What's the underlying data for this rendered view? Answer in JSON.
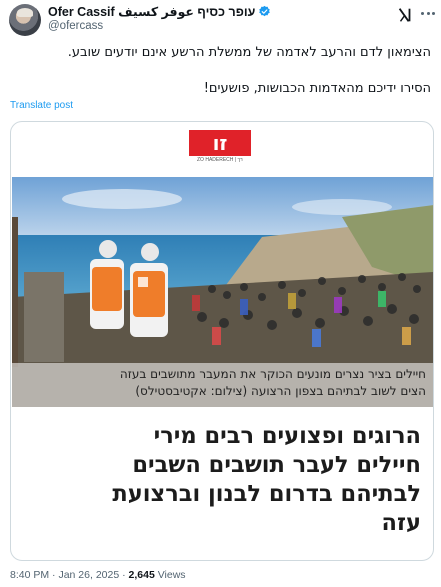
{
  "author": {
    "display_name": "Ofer Cassif עופר כסיף عوفر كسيف",
    "handle": "@ofercass",
    "verified": true
  },
  "icons": {
    "verified": "verified-badge-icon",
    "grok": "grok-icon",
    "more": "more-icon"
  },
  "colors": {
    "link": "#1d9bf0",
    "muted": "#536471",
    "logo_red": "#e02229"
  },
  "tweet": {
    "line1": "הצימאון לדם והרעב לאדמה של ממשלת הרשע אינם יודעים שובע.",
    "line2": "הסירו ידיכם מהאדמות הכבושות, פושעים!",
    "translate_label": "Translate post"
  },
  "article": {
    "logo_text": "זו הדרך",
    "logo_sub": "ZO HADERECH | זו הדרך",
    "caption_line1": "חיילים בציר נצרים מונעים הכוקר את המעבר מתושבים בעזה",
    "caption_line2": "הצים לשוב לבתיהם בצפון הרצועה (צילום: אקטיבסטילס)",
    "headline_lines": [
      "הרוגים ופצועים רבים מירי",
      "חיילים לעבר תושבים השבים",
      "לבתיהם בדרום לבנון וברצועת",
      "עזה"
    ]
  },
  "meta": {
    "time": "8:40 PM",
    "separator": "·",
    "date": "Jan 26, 2025",
    "views_count": "2,645",
    "views_label": "Views"
  }
}
